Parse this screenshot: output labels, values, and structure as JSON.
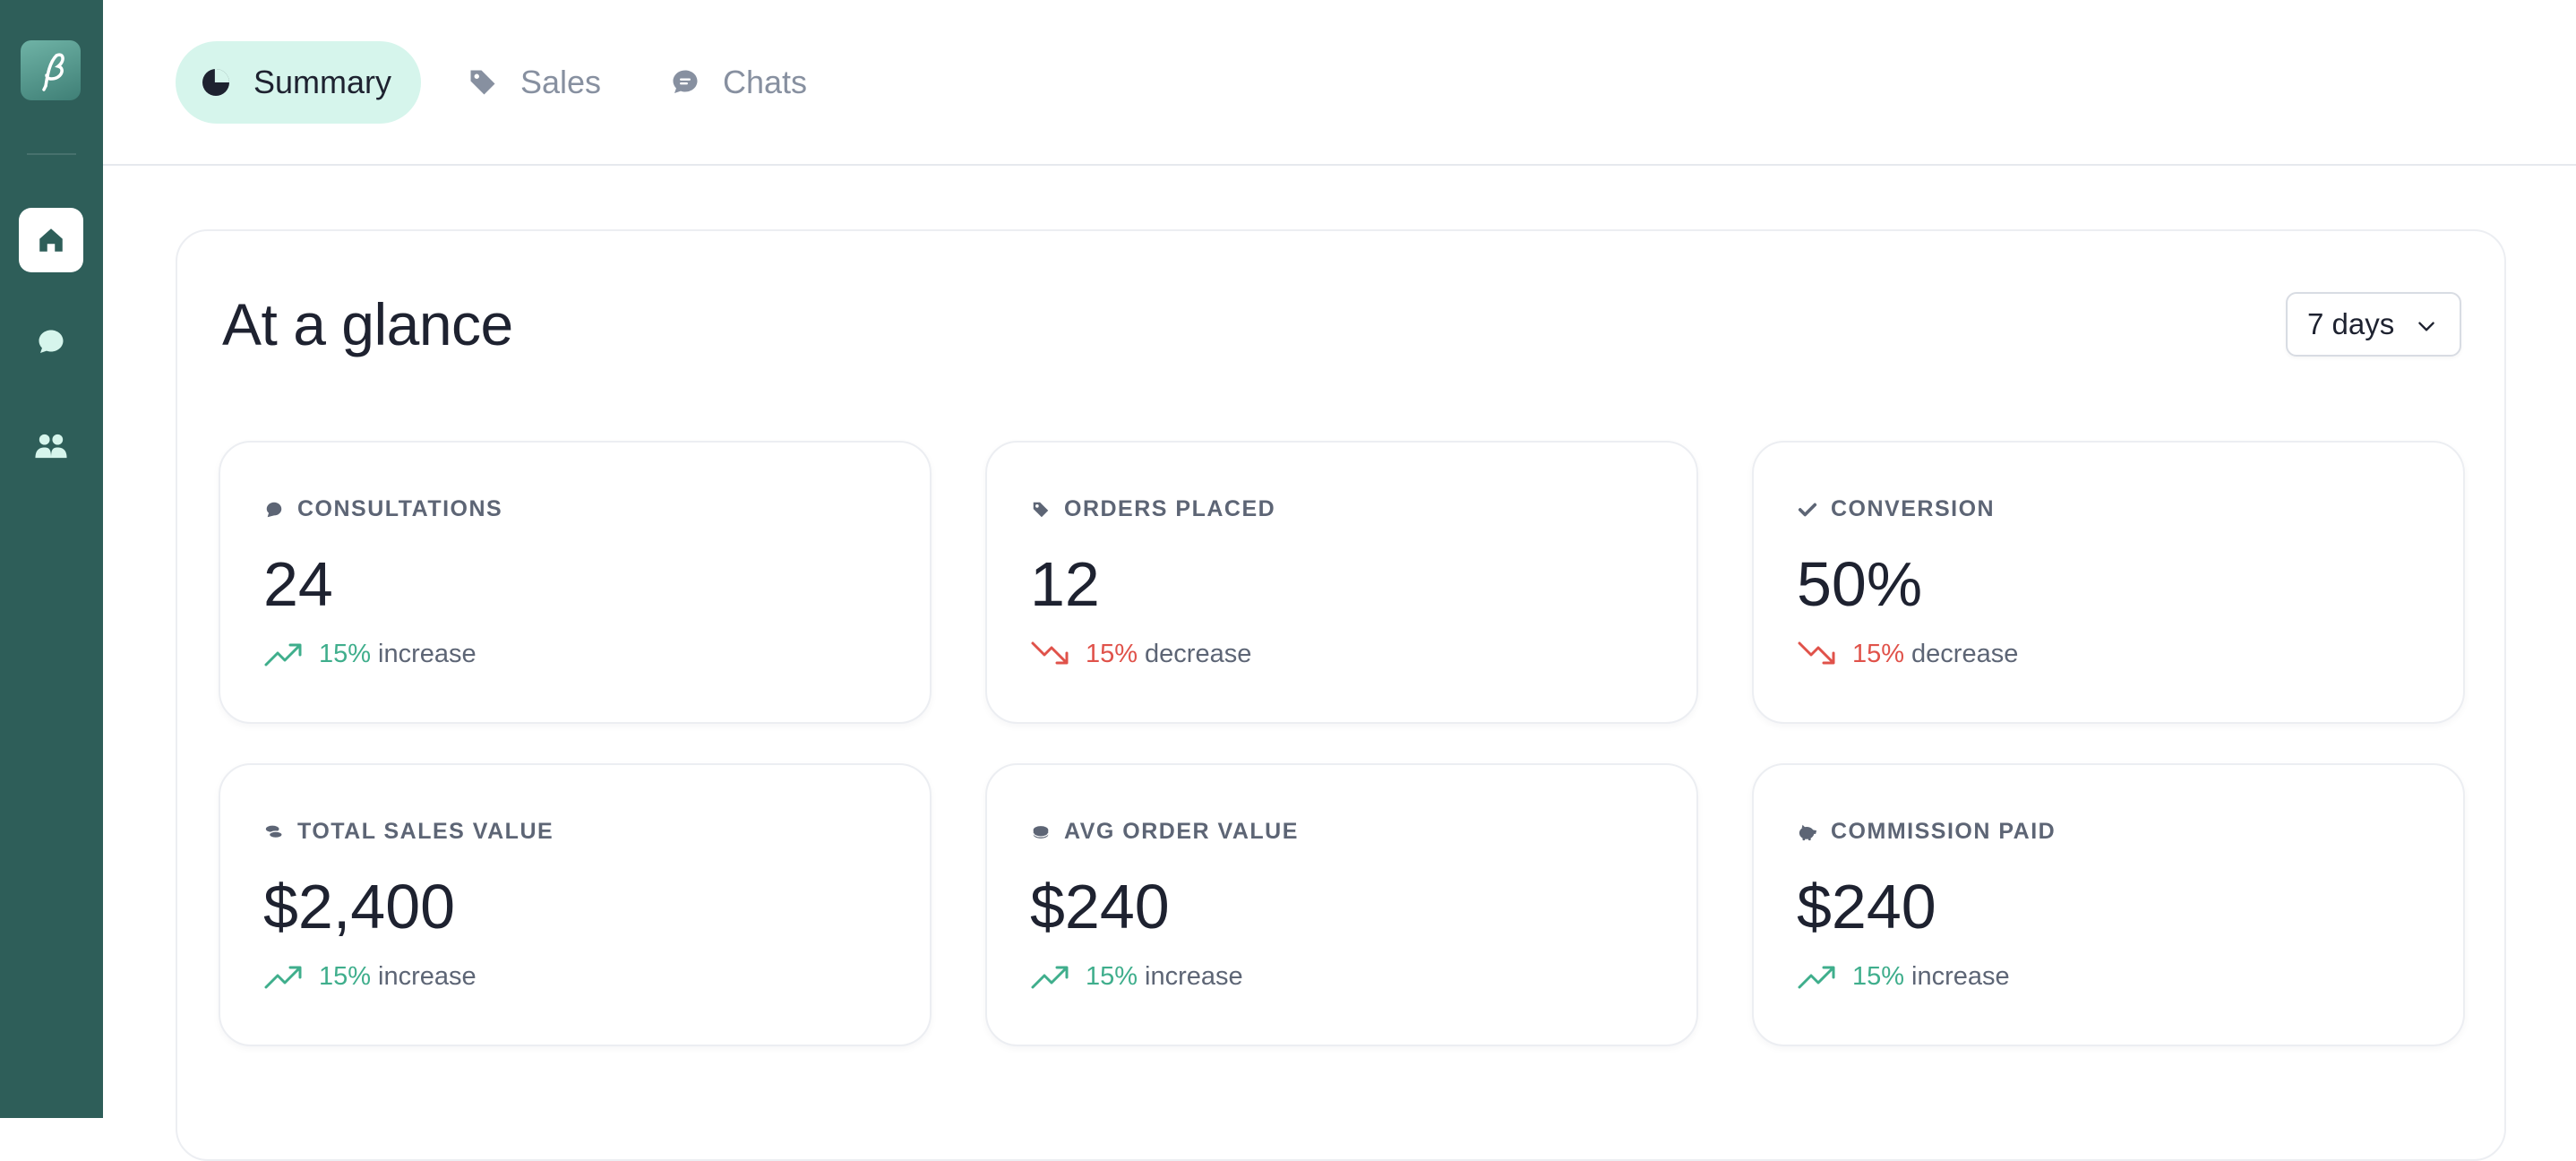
{
  "tabs": [
    {
      "label": "Summary",
      "icon": "pie-chart-icon",
      "active": true
    },
    {
      "label": "Sales",
      "icon": "tag-icon",
      "active": false
    },
    {
      "label": "Chats",
      "icon": "chat-icon",
      "active": false
    }
  ],
  "sidebar": {
    "logo": "brand-logo",
    "items": [
      {
        "icon": "home-icon",
        "active": true
      },
      {
        "icon": "chat-bubble-icon",
        "active": false
      },
      {
        "icon": "users-icon",
        "active": false
      }
    ]
  },
  "panel": {
    "title": "At a glance",
    "period": "7 days"
  },
  "cards": [
    {
      "label": "CONSULTATIONS",
      "icon": "chat-icon",
      "value": "24",
      "pct": "15%",
      "trend": "increase",
      "dir": "up"
    },
    {
      "label": "ORDERS PLACED",
      "icon": "tag-icon",
      "value": "12",
      "pct": "15%",
      "trend": "decrease",
      "dir": "down"
    },
    {
      "label": "CONVERSION",
      "icon": "check-icon",
      "value": "50%",
      "pct": "15%",
      "trend": "decrease",
      "dir": "down"
    },
    {
      "label": "TOTAL SALES VALUE",
      "icon": "coins-icon",
      "value": "$2,400",
      "pct": "15%",
      "trend": "increase",
      "dir": "up"
    },
    {
      "label": "AVG ORDER VALUE",
      "icon": "coin-icon",
      "value": "$240",
      "pct": "15%",
      "trend": "increase",
      "dir": "up"
    },
    {
      "label": "COMMISSION PAID",
      "icon": "piggy-bank-icon",
      "value": "$240",
      "pct": "15%",
      "trend": "increase",
      "dir": "up"
    }
  ],
  "colors": {
    "sidebar": "#2e5e59",
    "accent_tab": "#d6f5ec",
    "increase": "#3fae8c",
    "decrease": "#e0524a"
  }
}
